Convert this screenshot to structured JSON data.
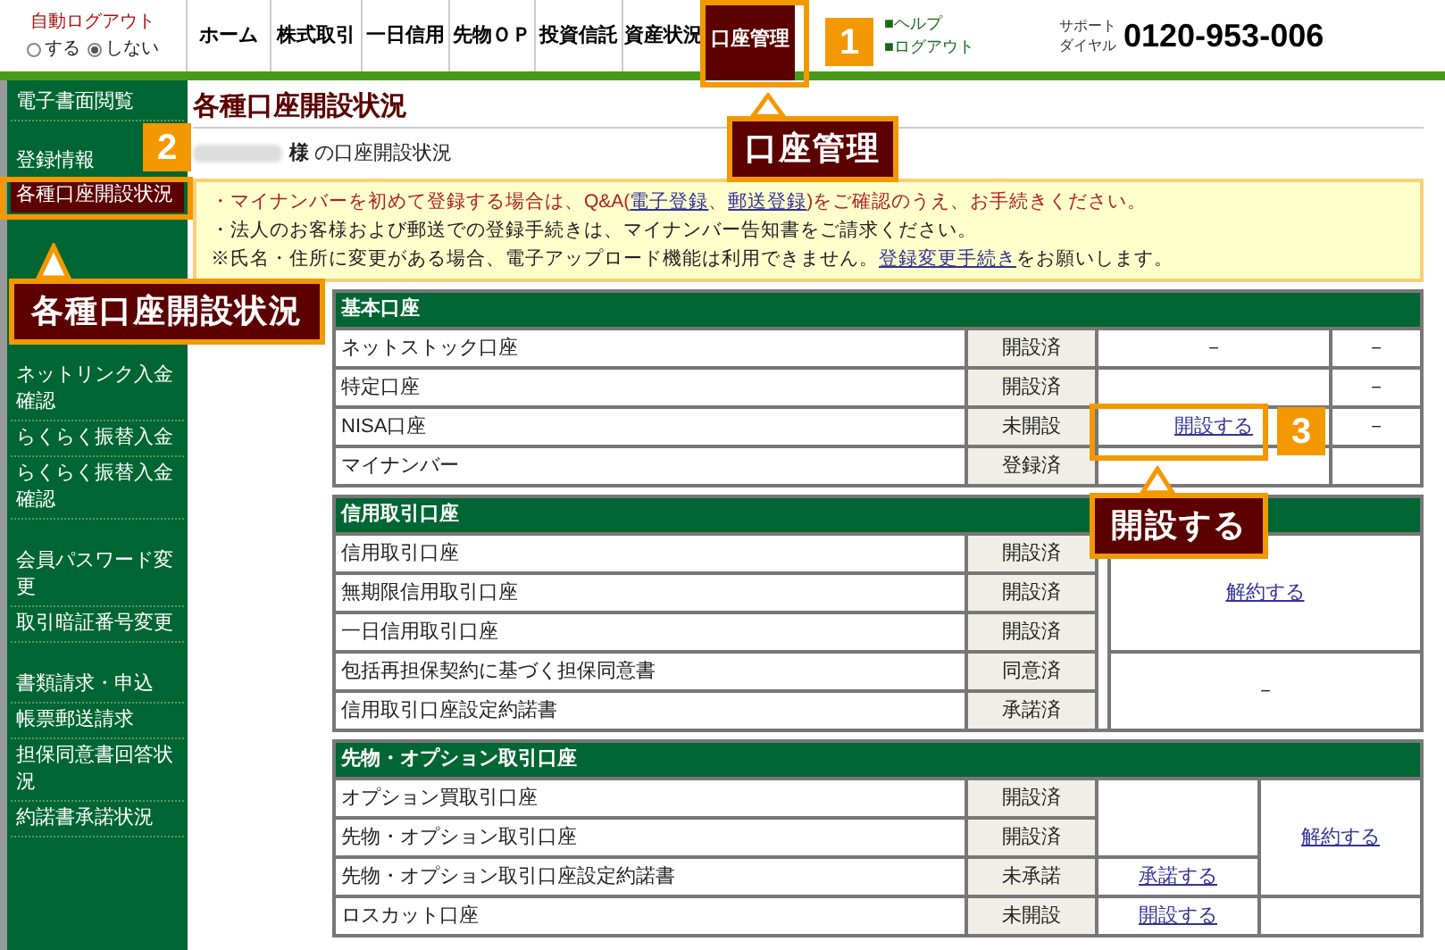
{
  "header": {
    "auto_logout": {
      "label": "自動ログアウト",
      "options": [
        {
          "label": "する",
          "selected": false
        },
        {
          "label": "しない",
          "selected": true
        }
      ]
    },
    "nav": [
      {
        "label": "ホーム",
        "selected": false
      },
      {
        "label": "株式取引",
        "selected": false
      },
      {
        "label": "一日信用",
        "selected": false
      },
      {
        "label": "先物ＯＰ",
        "selected": false
      },
      {
        "label": "投資信託",
        "selected": false
      },
      {
        "label": "資産状況",
        "selected": false
      },
      {
        "label": "口座管理",
        "selected": true
      }
    ],
    "links": [
      "■ヘルプ",
      "■ログアウト"
    ],
    "support": {
      "label_top": "サポート",
      "label_bottom": "ダイヤル",
      "phone": "0120-953-006"
    }
  },
  "sidebar": {
    "groups": [
      [
        {
          "label": "電子書面閲覧",
          "kind": "link",
          "selected": false
        }
      ],
      [
        {
          "label": "登録情報",
          "kind": "heading",
          "selected": false
        },
        {
          "label": "各種口座開設状況",
          "kind": "link",
          "selected": true
        }
      ],
      [
        {
          "label": "ネットリンク入金確認",
          "kind": "link",
          "selected": false
        },
        {
          "label": "らくらく振替入金",
          "kind": "link",
          "selected": false
        },
        {
          "label": "らくらく振替入金確認",
          "kind": "link",
          "selected": false
        }
      ],
      [
        {
          "label": "会員パスワード変更",
          "kind": "link",
          "selected": false
        },
        {
          "label": "取引暗証番号変更",
          "kind": "link",
          "selected": false
        }
      ],
      [
        {
          "label": "書類請求・申込",
          "kind": "link",
          "selected": false
        },
        {
          "label": "帳票郵送請求",
          "kind": "link",
          "selected": false
        },
        {
          "label": "担保同意書回答状況",
          "kind": "link",
          "selected": false
        },
        {
          "label": "約諾書承諾状況",
          "kind": "link",
          "selected": false
        }
      ]
    ]
  },
  "page": {
    "title": "各種口座開設状況",
    "greeting": "**様** の口座開設状況",
    "notice": [
      {
        "kind": "warning",
        "segments": [
          {
            "kind": "text",
            "text": "・マイナンバーを初めて登録する場合は、Q&A("
          },
          {
            "kind": "link",
            "text": "電子登録"
          },
          {
            "kind": "text",
            "text": "、"
          },
          {
            "kind": "link",
            "text": "郵送登録"
          },
          {
            "kind": "text",
            "text": ")をご確認のうえ、お手続きください。"
          }
        ]
      },
      {
        "kind": "normal",
        "segments": [
          {
            "kind": "text",
            "text": "・法人のお客様および郵送での登録手続きは、マイナンバー告知書をご請求ください。"
          }
        ]
      },
      {
        "kind": "normal",
        "segments": [
          {
            "kind": "text",
            "text": "※氏名・住所に変更がある場合、電子アップロード機能は利用できません。"
          },
          {
            "kind": "link",
            "text": "登録変更手続き"
          },
          {
            "kind": "text",
            "text": "をお願いします。"
          }
        ]
      }
    ],
    "sections": [
      {
        "title": "基本口座",
        "rows": [
          {
            "name": "ネットストック口座",
            "status": "開設済",
            "action": {
              "kind": "text",
              "text": "－"
            },
            "note": {
              "kind": "text",
              "text": "－"
            }
          },
          {
            "name": "特定口座",
            "status": "開設済",
            "action": {
              "kind": "empty"
            },
            "note": {
              "kind": "text",
              "text": "－"
            }
          },
          {
            "name": "NISA口座",
            "status": "未開設",
            "action": {
              "kind": "link",
              "text": "開設する"
            },
            "note": {
              "kind": "text",
              "text": "－"
            }
          },
          {
            "name": "マイナンバー",
            "status": "登録済",
            "action": {
              "kind": "empty"
            },
            "note": {
              "kind": "empty"
            }
          }
        ]
      },
      {
        "title": "信用取引口座",
        "rows": [
          {
            "name": "信用取引口座",
            "status": "開設済",
            "action": {
              "kind": "empty"
            },
            "note": {
              "kind": "link",
              "text": "解約する"
            }
          },
          {
            "name": "無期限信用取引口座",
            "status": "開設済",
            "action": {
              "kind": "continued"
            },
            "note": {
              "kind": "continued"
            }
          },
          {
            "name": "一日信用取引口座",
            "status": "開設済",
            "action": {
              "kind": "continued"
            },
            "note": {
              "kind": "continued"
            }
          },
          {
            "name": "包括再担保契約に基づく担保同意書",
            "status": "同意済",
            "action": {
              "kind": "continued"
            },
            "note": {
              "kind": "text",
              "text": "－"
            }
          },
          {
            "name": "信用取引口座設定約諾書",
            "status": "承諾済",
            "action": {
              "kind": "continued"
            },
            "note": {
              "kind": "continued"
            }
          }
        ]
      },
      {
        "title": "先物・オプション取引口座",
        "rows": [
          {
            "name": "オプション買取引口座",
            "status": "開設済",
            "action": {
              "kind": "empty"
            },
            "note": {
              "kind": "link",
              "text": "解約する"
            }
          },
          {
            "name": "先物・オプション取引口座",
            "status": "開設済",
            "action": {
              "kind": "continued"
            },
            "note": {
              "kind": "continued"
            }
          },
          {
            "name": "先物・オプション取引口座設定約諾書",
            "status": "未承諾",
            "action": {
              "kind": "link",
              "text": "承諾する"
            },
            "note": {
              "kind": "continued"
            }
          },
          {
            "name": "ロスカット口座",
            "status": "未開設",
            "action": {
              "kind": "link",
              "text": "開設する"
            },
            "note": {
              "kind": "empty"
            }
          }
        ]
      }
    ]
  },
  "callouts": [
    {
      "number": "1",
      "label": "口座管理"
    },
    {
      "number": "2",
      "label": "各種口座開設状況"
    },
    {
      "number": "3",
      "label": "開設する"
    }
  ]
}
